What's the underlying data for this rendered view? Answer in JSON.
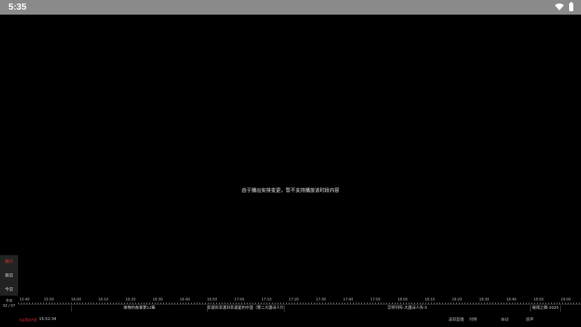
{
  "status_bar": {
    "time": "5:35",
    "icons": [
      "wifi-icon",
      "battery-icon"
    ]
  },
  "player": {
    "message": "由于播出安排变更，暂不支持播放该时段内容"
  },
  "day_selector": {
    "items": [
      "周六",
      "周日",
      "今日"
    ],
    "active_index": 0
  },
  "timeline": {
    "today_label": "今日",
    "date_label": "02 / 07",
    "ticks": [
      "15:40",
      "15:50",
      "16:00",
      "16:10",
      "16:20",
      "16:30",
      "16:40",
      "16:50",
      "17:00",
      "17:10",
      "17:20",
      "17:30",
      "17:40",
      "17:50",
      "18:00",
      "18:10",
      "18:20",
      "18:30",
      "18:40",
      "18:50",
      "19:00"
    ],
    "programs": [
      "故物的故事第12集",
      "幸運到幸運到幸運星的中国（第二大唐诗人片",
      "宗师列传-大唐诗人传-5",
      "秘境之眼-2025"
    ]
  },
  "bottom_bar": {
    "date": "02月07日",
    "time": "15:52:34",
    "controls": [
      "返回直播",
      "时移",
      "自动",
      "原声"
    ]
  }
}
